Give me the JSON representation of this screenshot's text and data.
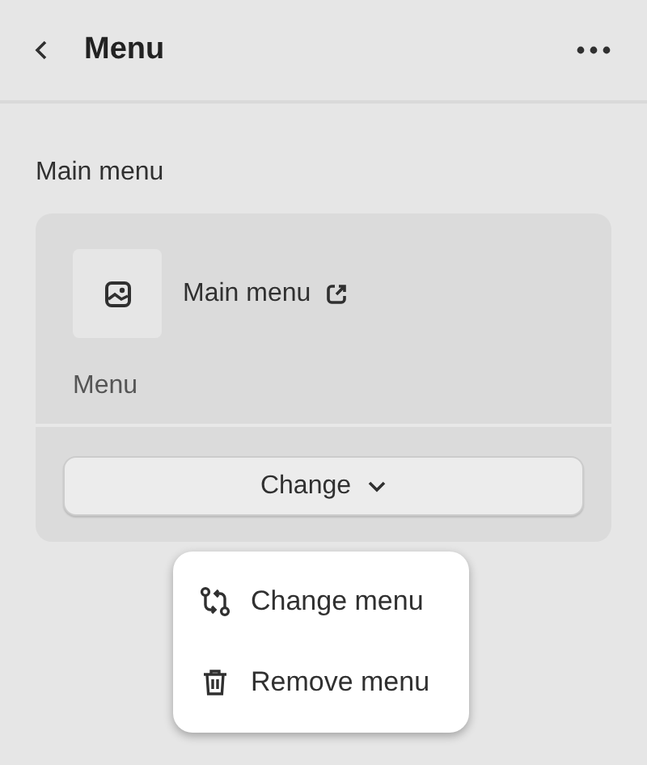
{
  "header": {
    "title": "Menu"
  },
  "section": {
    "label": "Main menu"
  },
  "card": {
    "name": "Main menu",
    "type_label": "Menu",
    "button": "Change"
  },
  "dropdown": [
    {
      "kind": "change",
      "label": "Change menu"
    },
    {
      "kind": "remove",
      "label": "Remove menu"
    }
  ]
}
